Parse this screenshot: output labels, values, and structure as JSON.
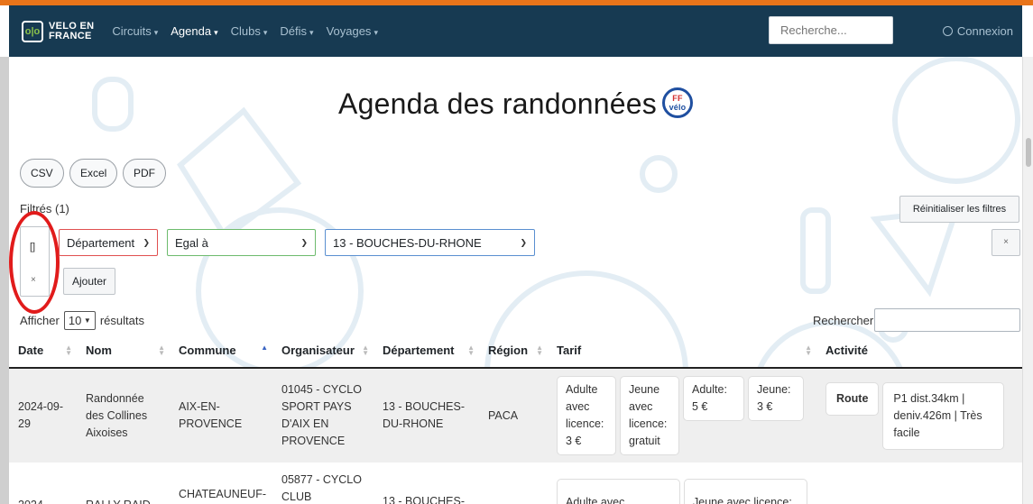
{
  "brand": {
    "line1": "VELO EN",
    "line2": "FRANCE",
    "logo_glyph": "o|o"
  },
  "nav": {
    "items": [
      {
        "label": "Circuits",
        "active": false
      },
      {
        "label": "Agenda",
        "active": true
      },
      {
        "label": "Clubs",
        "active": false
      },
      {
        "label": "Défis",
        "active": false
      },
      {
        "label": "Voyages",
        "active": false
      }
    ],
    "search_placeholder": "Recherche...",
    "login_label": "Connexion"
  },
  "page": {
    "title": "Agenda des randonnées",
    "logo_ff": "FF",
    "logo_velo": "vélo"
  },
  "export": {
    "csv": "CSV",
    "excel": "Excel",
    "pdf": "PDF"
  },
  "filters": {
    "label": "Filtrés (1)",
    "reset_label": "Réinitialiser les filtres",
    "group_icon": "[]",
    "group_remove": "×",
    "field": "Département",
    "operator": "Egal à",
    "value": "13 - BOUCHES-DU-RHONE",
    "clear": "×",
    "add_label": "Ajouter"
  },
  "length": {
    "prefix": "Afficher",
    "value": "10",
    "suffix": "résultats"
  },
  "table_search": {
    "label": "Rechercher"
  },
  "table": {
    "columns": [
      "Date",
      "Nom",
      "Commune",
      "Organisateur",
      "Département",
      "Région",
      "Tarif",
      "Activité"
    ],
    "rows": [
      {
        "date": "2024-09-29",
        "nom": "Randonnée des Collines Aixoises",
        "commune": "AIX-EN-PROVENCE",
        "organisateur": "01045 - CYCLO SPORT PAYS D'AIX EN PROVENCE",
        "departement": "13 - BOUCHES-DU-RHONE",
        "region": "PACA",
        "tarif": [
          {
            "label": "Adulte avec licence:",
            "value": "3 €"
          },
          {
            "label": "Jeune avec licence:",
            "value": "gratuit"
          },
          {
            "label": "Adulte:",
            "value": "5 €"
          },
          {
            "label": "Jeune:",
            "value": "3 €"
          }
        ],
        "activite": {
          "type": "Route",
          "detail": "P1 dist.34km | deniv.426m | Très facile"
        }
      },
      {
        "date": "2024-",
        "nom": "RALLY RAID",
        "commune": "CHATEAUNEUF-",
        "organisateur": "05877 - CYCLO CLUB",
        "departement": "13 - BOUCHES-",
        "region": "",
        "tarif": [
          {
            "label": "Adulte avec",
            "value": ""
          },
          {
            "label": "Jeune avec licence:",
            "value": ""
          }
        ],
        "activite": {
          "type": "",
          "detail": ""
        }
      }
    ]
  },
  "colors": {
    "navbar": "#173a52",
    "accent_stripe": "#e8741a",
    "annotation_circle": "#e11b1b"
  }
}
